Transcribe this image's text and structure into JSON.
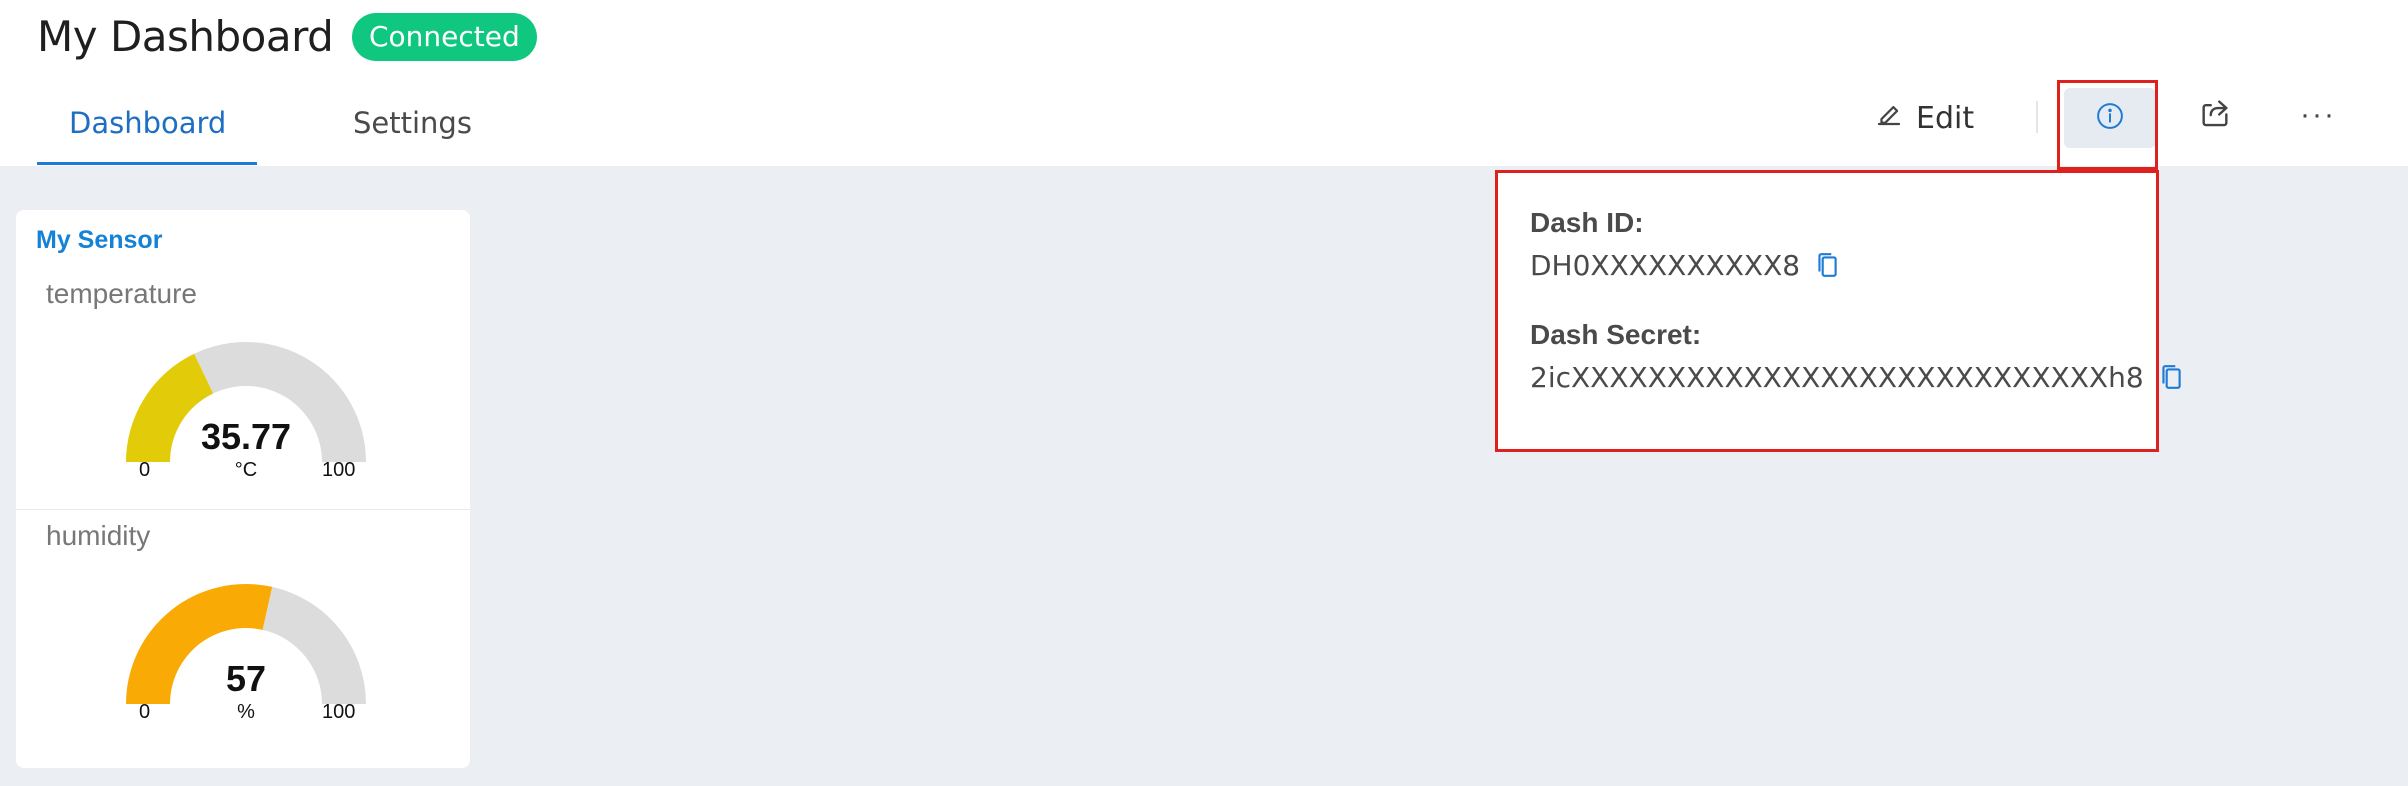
{
  "header": {
    "title": "My Dashboard",
    "status_badge": "Connected",
    "tabs": [
      {
        "label": "Dashboard",
        "active": true
      },
      {
        "label": "Settings",
        "active": false
      }
    ],
    "toolbar": {
      "edit_label": "Edit",
      "more_label": "···"
    }
  },
  "popover": {
    "dash_id_label": "Dash ID:",
    "dash_id_value": "DH0XXXXXXXXXX8",
    "dash_secret_label": "Dash Secret:",
    "dash_secret_value": "2icXXXXXXXXXXXXXXXXXXXXXXXXXXXXh8"
  },
  "card": {
    "title": "My Sensor",
    "widgets": [
      {
        "label": "temperature",
        "value": "35.77",
        "unit": "°C",
        "min": "0",
        "max": "100",
        "fraction": 0.3577,
        "color": "#e2cc0a"
      },
      {
        "label": "humidity",
        "value": "57",
        "unit": "%",
        "min": "0",
        "max": "100",
        "fraction": 0.57,
        "color": "#f9aa04"
      }
    ]
  },
  "colors": {
    "accent": "#1e7bd6",
    "connected": "#10c77f",
    "highlight": "#e01f1f",
    "gauge_track": "#dcdcdc"
  }
}
